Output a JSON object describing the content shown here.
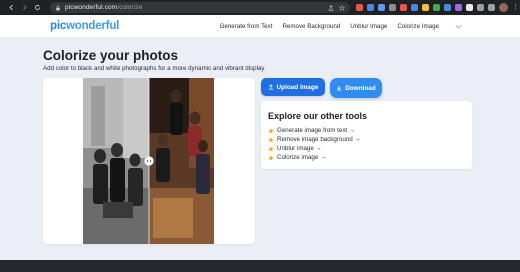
{
  "browser": {
    "url_host": "picwonderful.com",
    "url_path": "/colorize",
    "icons": [
      "back-icon",
      "forward-icon",
      "reload-icon",
      "lock-icon",
      "share-icon",
      "bookmark-star-icon"
    ]
  },
  "header": {
    "logo_pic": "pic",
    "logo_rest": "wonderful",
    "menu": [
      {
        "label": "Generate from Text"
      },
      {
        "label": "Remove Background"
      },
      {
        "label": "Unblur Image"
      },
      {
        "label": "Colorize Image"
      }
    ]
  },
  "main": {
    "title": "Colorize your photos",
    "subtitle": "Add color to black and white photographs for a more dynamic and vibrant display",
    "upload_label": "Upload Image",
    "download_label": "Download"
  },
  "tools": {
    "title": "Explore our other tools",
    "items": [
      {
        "label": "Generate image from text →"
      },
      {
        "label": "Remove image background →"
      },
      {
        "label": "Unblur image →"
      },
      {
        "label": "Colorize image →"
      }
    ]
  },
  "colors": {
    "accent": "#1f6fe0",
    "accent_light": "#2f8cf0",
    "star": "#f5a524",
    "page_bg": "#ebeef5"
  }
}
